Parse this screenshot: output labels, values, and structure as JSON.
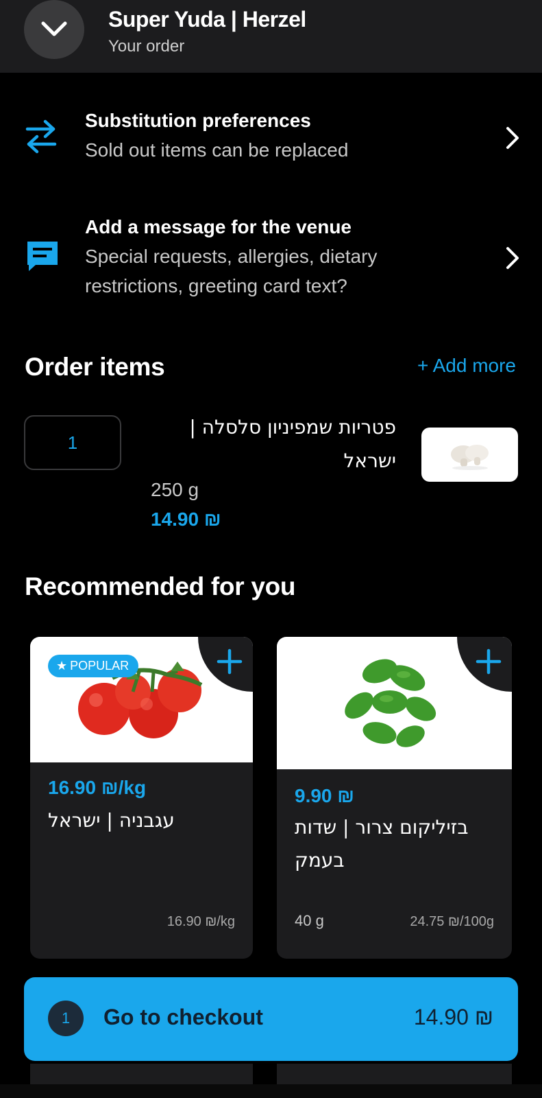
{
  "header": {
    "venue_name": "Super Yuda | Herzel",
    "subtitle": "Your order"
  },
  "substitution": {
    "title": "Substitution preferences",
    "subtitle": "Sold out items can be replaced"
  },
  "venue_message": {
    "title": "Add a message for the venue",
    "subtitle": "Special requests, allergies, dietary restrictions, greeting card text?"
  },
  "order_items": {
    "title": "Order items",
    "add_more": "+ Add more",
    "items": [
      {
        "quantity": "1",
        "name": "פטריות שמפיניון סלסלה | ישראל",
        "weight": "250 g",
        "price": "14.90 ₪"
      }
    ]
  },
  "recommended": {
    "title": "Recommended for you",
    "cards": [
      {
        "badge": "POPULAR",
        "price": "16.90 ₪/kg",
        "name": "עגבניה | ישראל",
        "weight": "",
        "unit_price": "16.90 ₪/kg"
      },
      {
        "badge": "",
        "price": "9.90 ₪",
        "name": "בזיליקום צרור | שדות בעמק",
        "weight": "40 g",
        "unit_price": "24.75 ₪/100g"
      }
    ]
  },
  "checkout": {
    "count": "1",
    "label": "Go to checkout",
    "total": "14.90 ₪"
  },
  "colors": {
    "accent": "#1aa7ec",
    "background": "#000000",
    "surface": "#1c1c1e"
  },
  "icons": {
    "back": "chevron-down-icon",
    "substitution": "swap-arrows-icon",
    "message": "chat-bubble-icon",
    "row_arrow": "chevron-right-icon",
    "add": "plus-icon",
    "badge": "star-icon"
  }
}
